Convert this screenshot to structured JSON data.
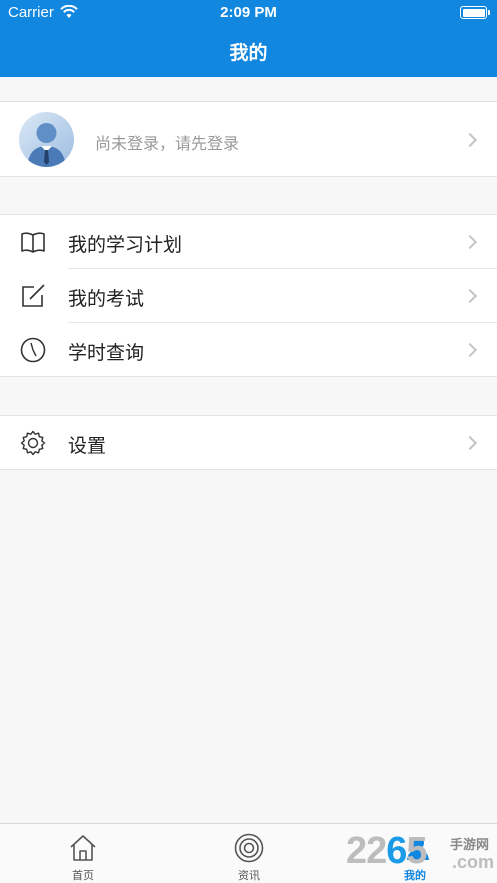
{
  "status_bar": {
    "carrier": "Carrier",
    "time": "2:09 PM"
  },
  "nav": {
    "title": "我的"
  },
  "profile": {
    "login_prompt": "尚未登录，请先登录"
  },
  "menu": {
    "items": [
      {
        "label": "我的学习计划",
        "icon": "book-icon"
      },
      {
        "label": "我的考试",
        "icon": "edit-icon"
      },
      {
        "label": "学时查询",
        "icon": "clock-icon"
      }
    ]
  },
  "settings": {
    "label": "设置",
    "icon": "gear-icon"
  },
  "tabbar": {
    "tabs": [
      {
        "label": "首页",
        "icon": "home-icon"
      },
      {
        "label": "资讯",
        "icon": "target-icon"
      },
      {
        "label": "我的",
        "icon": "user-icon",
        "active": true
      }
    ]
  },
  "watermark": {
    "digits_a": "22",
    "digits_b": "6",
    "digits_c": "5",
    "cn": "手游网",
    "com": ".com"
  },
  "colors": {
    "accent": "#1187e0",
    "background": "#f7f7f7"
  }
}
